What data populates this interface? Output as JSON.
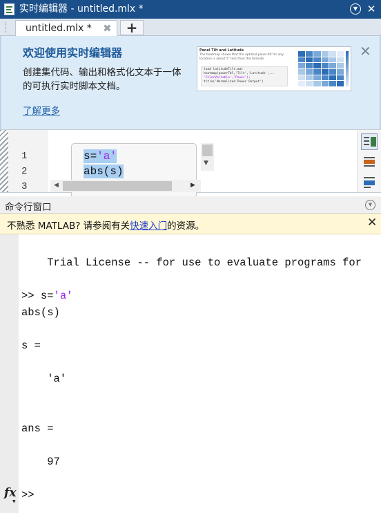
{
  "window": {
    "title": "实时编辑器 - untitled.mlx *",
    "menu_glyph": "▼",
    "close_glyph": "✕"
  },
  "tabs": {
    "active_label": "untitled.mlx *",
    "close_glyph": "✖",
    "add_glyph": "+"
  },
  "welcome": {
    "title": "欢迎使用实时编辑器",
    "description": "创建集代码、输出和格式化文本于一体的可执行实时脚本文档。",
    "link": "了解更多",
    "close_glyph": "✕",
    "thumbnail": {
      "title": "Panel Tilt and Latitude",
      "description": "The heatmap shows that the optimal panel tilt for any location is about 5° less than the latitude",
      "code": [
        "load latitudeTilt.mat",
        "heatmap(powerTbl,'Tilt','Latitude',...",
        "    'ColorVariable','Power');",
        "title('Normalized Power Output')"
      ],
      "heat_colors": [
        "#2d6db5",
        "#4a86c6",
        "#7aa8d8",
        "#a9c8e8",
        "#cfe0f3",
        "#e4eef9",
        "#4a86c6",
        "#2d6db5",
        "#4a86c6",
        "#7aa8d8",
        "#a9c8e8",
        "#cfe0f3",
        "#7aa8d8",
        "#4a86c6",
        "#2d6db5",
        "#4a86c6",
        "#7aa8d8",
        "#a9c8e8",
        "#a9c8e8",
        "#7aa8d8",
        "#4a86c6",
        "#2d6db5",
        "#4a86c6",
        "#7aa8d8",
        "#cfe0f3",
        "#a9c8e8",
        "#7aa8d8",
        "#4a86c6",
        "#2d6db5",
        "#4a86c6",
        "#e4eef9",
        "#cfe0f3",
        "#a9c8e8",
        "#7aa8d8",
        "#4a86c6",
        "#2d6db5"
      ]
    }
  },
  "editor": {
    "line_numbers": [
      "1",
      "2",
      "3"
    ],
    "code_line1_prefix": "s=",
    "code_line1_string": "'a'",
    "code_line2": "abs(s)",
    "scroll_up_glyph": "▼",
    "scroll_left_glyph": "◀",
    "scroll_right_glyph": "▶"
  },
  "command_window": {
    "title": "命令行窗口",
    "menu_glyph": "▼",
    "info_before": "不熟悉 MATLAB? 请参阅有关",
    "info_link": "快速入门",
    "info_after": "的资源。",
    "info_close_glyph": "✕",
    "trial_line": "    Trial License -- for use to evaluate programs for",
    "cmd_prompt_prefix": ">> s=",
    "cmd_prompt_string": "'a'",
    "cmd_line2": "abs(s)",
    "out_s_label": "s =",
    "out_s_value": "    'a'",
    "out_ans_label": "ans =",
    "out_ans_value": "    97",
    "final_prompt": ">>",
    "fx_label": "fx",
    "fx_arrow": "▼"
  },
  "colors": {
    "titlebar_bg": "#1b4f8a",
    "banner_bg": "#dcebf8",
    "banner_title": "#1f5b99",
    "string_literal": "#a020f0",
    "selection": "#a8cef2",
    "infobar_bg": "#fff7d6"
  }
}
